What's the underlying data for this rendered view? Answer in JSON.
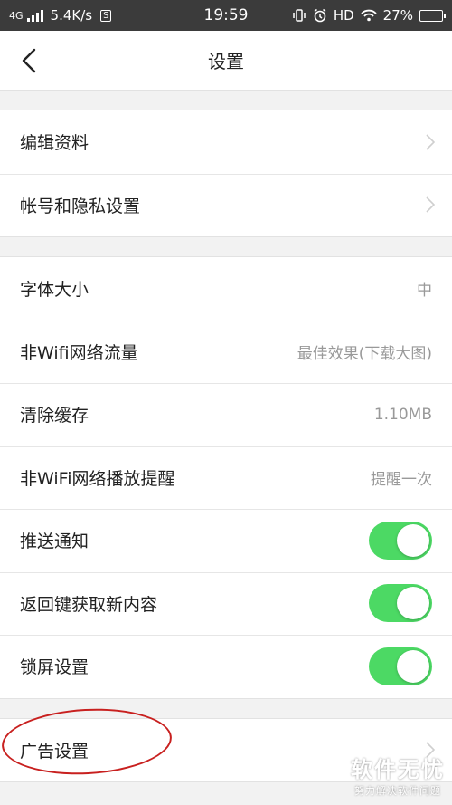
{
  "status_bar": {
    "network": "4G",
    "speed": "5.4K/s",
    "sim_badge": "S",
    "time": "19:59",
    "hd": "HD",
    "battery": "27%",
    "battery_level": 0.27
  },
  "header": {
    "title": "设置",
    "back_icon": "chevron-left-icon"
  },
  "sections": {
    "account": {
      "edit_profile": "编辑资料",
      "account_privacy": "帐号和隐私设置"
    },
    "general": {
      "font_size_label": "字体大小",
      "font_size_value": "中",
      "non_wifi_traffic_label": "非Wifi网络流量",
      "non_wifi_traffic_value": "最佳效果(下载大图)",
      "clear_cache_label": "清除缓存",
      "clear_cache_value": "1.10MB",
      "non_wifi_play_label": "非WiFi网络播放提醒",
      "non_wifi_play_value": "提醒一次",
      "push_label": "推送通知",
      "push_on": true,
      "back_refresh_label": "返回键获取新内容",
      "back_refresh_on": true,
      "lock_screen_label": "锁屏设置",
      "lock_screen_on": true
    },
    "ads": {
      "ad_settings": "广告设置"
    }
  },
  "colors": {
    "toggle_on": "#4cd964",
    "annotation": "#c8201f"
  },
  "watermark": {
    "title": "软件无忧",
    "subtitle": "努力解决软件问题"
  }
}
